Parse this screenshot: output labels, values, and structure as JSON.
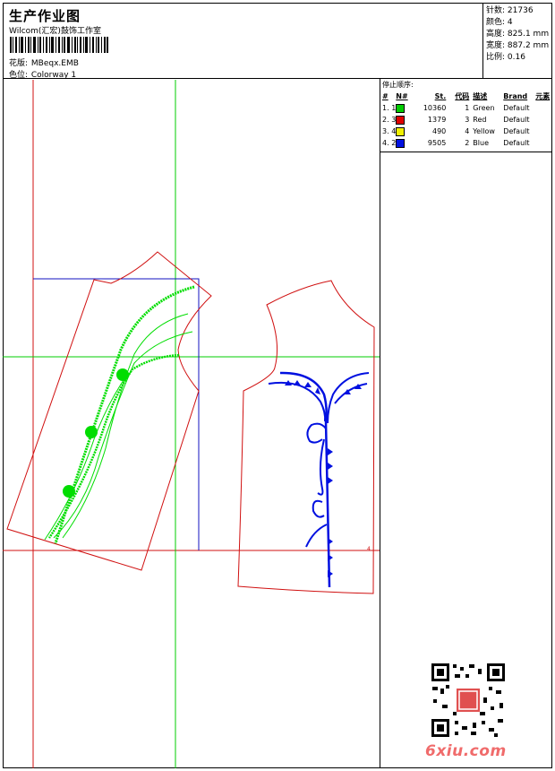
{
  "header": {
    "title": "生产作业图",
    "subtitle": "Wilcom(汇宏)鼓饰工作室",
    "design_label": "花版:",
    "design_value": "MBeqx.EMB",
    "colorway_label": "色位:",
    "colorway_value": "Colorway 1"
  },
  "stats": [
    {
      "label": "针数:",
      "value": "21736"
    },
    {
      "label": "颜色:",
      "value": "4"
    },
    {
      "label": "高度:",
      "value": "825.1 mm"
    },
    {
      "label": "宽度:",
      "value": "887.2 mm"
    },
    {
      "label": "比例:",
      "value": "0.16"
    }
  ],
  "stop_panel": {
    "title": "停止顺序:",
    "columns": [
      "#",
      "N#",
      "St.",
      "代码",
      "描述",
      "Brand",
      "元素"
    ],
    "rows": [
      {
        "num": "1.",
        "n": "1",
        "color": "#00cc00",
        "st": "10360",
        "code": "1",
        "desc": "Green",
        "brand": "Default"
      },
      {
        "num": "2.",
        "n": "3",
        "color": "#e00000",
        "st": "1379",
        "code": "3",
        "desc": "Red",
        "brand": "Default"
      },
      {
        "num": "3.",
        "n": "4",
        "color": "#f0f000",
        "st": "490",
        "code": "4",
        "desc": "Yellow",
        "brand": "Default"
      },
      {
        "num": "4.",
        "n": "2",
        "color": "#0010e0",
        "st": "9505",
        "code": "2",
        "desc": "Blue",
        "brand": "Default"
      }
    ]
  },
  "watermark": "6xiu.com",
  "colors": {
    "guide": "#00cc00",
    "outline": "#d01010",
    "frame": "#1010c0",
    "blue_stitch": "#0010e0"
  }
}
